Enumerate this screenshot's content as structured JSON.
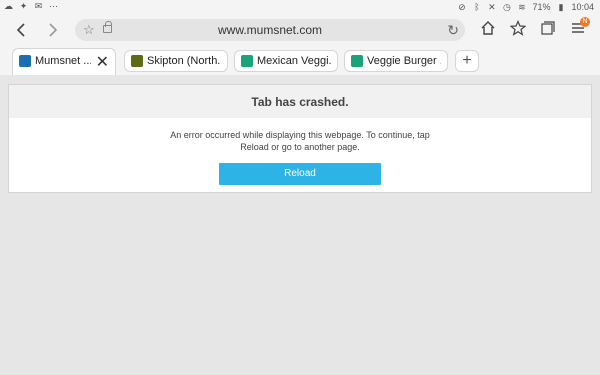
{
  "status": {
    "battery": "71%",
    "time": "10:04"
  },
  "toolbar": {
    "url": "www.mumsnet.com",
    "badge": "N"
  },
  "tabs": [
    {
      "title": "Mumsnet ...",
      "active": true,
      "favicon_color": "#1a6fb3"
    },
    {
      "title": "Skipton (North...",
      "favicon_color": "#5c6b14"
    },
    {
      "title": "Mexican Veggi...",
      "favicon_color": "#1aa37a"
    },
    {
      "title": "Veggie Burger ...",
      "favicon_color": "#1aa37a"
    }
  ],
  "crash": {
    "heading": "Tab has crashed.",
    "message_line1": "An error occurred while displaying this webpage. To continue, tap",
    "message_line2": "Reload or go to another page.",
    "button": "Reload"
  },
  "colors": {
    "reload_button": "#2db3e6",
    "badge": "#f07c2a"
  }
}
